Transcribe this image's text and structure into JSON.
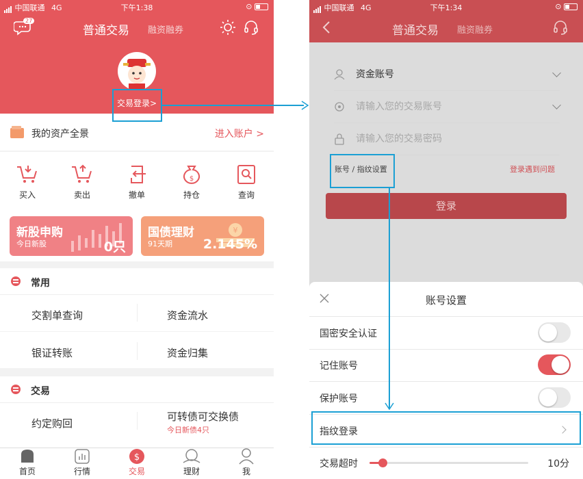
{
  "colors": {
    "brand_red": "#e5575c",
    "accent_blue": "#1a9fd4",
    "orange": "#f39a6a"
  },
  "left": {
    "status": {
      "carrier": "中国联通",
      "network": "4G",
      "time": "下午1:38"
    },
    "header": {
      "badge": "27",
      "title": "普通交易",
      "subtitle": "融资融券"
    },
    "login_text": "交易登录>",
    "assets": {
      "label": "我的资产全景",
      "link": "进入账户 >"
    },
    "actions": [
      {
        "label": "买入",
        "icon": "cart-buy-icon"
      },
      {
        "label": "卖出",
        "icon": "cart-sell-icon"
      },
      {
        "label": "撤单",
        "icon": "cancel-order-icon"
      },
      {
        "label": "持仓",
        "icon": "money-bag-icon"
      },
      {
        "label": "查询",
        "icon": "search-doc-icon"
      }
    ],
    "banners": [
      {
        "title": "新股申购",
        "sub": "今日新股",
        "value": "0只"
      },
      {
        "title": "国债理财",
        "sub": "91天期",
        "value": "2.145%"
      }
    ],
    "common": {
      "title": "常用",
      "items": [
        "交割单查询",
        "资金流水",
        "银证转账",
        "资金归集"
      ]
    },
    "trade": {
      "title": "交易",
      "items": [
        "约定购回",
        "可转债可交换债"
      ],
      "note": "今日新债4只"
    },
    "tabs": [
      "首页",
      "行情",
      "交易",
      "理财",
      "我"
    ]
  },
  "right": {
    "status": {
      "carrier": "中国联通",
      "network": "4G",
      "time": "下午1:34"
    },
    "header": {
      "title": "普通交易",
      "subtitle": "融资融券"
    },
    "form": {
      "account_type": "资金账号",
      "account_placeholder": "请输入您的交易账号",
      "password_placeholder": "请输入您的交易密码",
      "settings_link": "账号 / 指纹设置",
      "help_link": "登录遇到问题",
      "login_button": "登录"
    },
    "sheet": {
      "title": "账号设置",
      "rows": [
        {
          "label": "国密安全认证",
          "toggle": "off"
        },
        {
          "label": "记住账号",
          "toggle": "on"
        },
        {
          "label": "保护账号",
          "toggle": "off"
        }
      ],
      "fingerprint": "指纹登录",
      "timeout_label": "交易超时",
      "timeout_value": "10分",
      "timeout_fraction": 0.08
    }
  }
}
